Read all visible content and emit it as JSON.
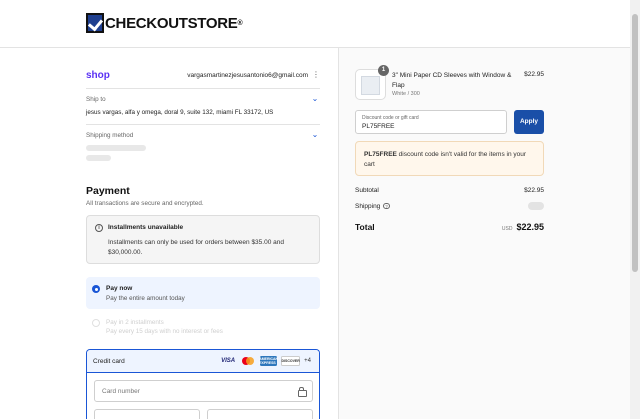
{
  "header": {
    "brand": "CHECKOUTSTORE",
    "brand_mark": "®"
  },
  "account": {
    "shop_logo": "shop",
    "email": "vargasmartinezjesusantonio6@gmail.com",
    "menu_icon": "more-vertical-icon"
  },
  "ship_to": {
    "label": "Ship to",
    "value": "jesus vargas, alfa y omega, doral 9, suite 132, miami FL 33172, US"
  },
  "shipping_method": {
    "label": "Shipping method"
  },
  "payment": {
    "title": "Payment",
    "subtitle": "All transactions are secure and encrypted.",
    "notice": {
      "title": "Installments unavailable",
      "body": "Installments can only be used for orders between $35.00 and $30,000.00."
    },
    "options": [
      {
        "title": "Pay now",
        "subtitle": "Pay the entire amount today",
        "selected": true
      },
      {
        "title": "Pay in 2 installments",
        "subtitle": "Pay every 15 days with no interest or fees",
        "selected": false
      }
    ],
    "credit_card": {
      "title": "Credit card",
      "brands": [
        "VISA",
        "MASTERCARD",
        "AMERICAN EXPRESS",
        "DISCOVER"
      ],
      "more": "+4",
      "card_number_placeholder": "Card number"
    }
  },
  "summary": {
    "product": {
      "quantity": "1",
      "name": "3\" Mini Paper CD Sleeves with Window & Flap",
      "variant": "White / 300",
      "price": "$22.95"
    },
    "discount": {
      "label": "Discount code or gift card",
      "value": "PL75FREE",
      "apply_label": "Apply",
      "error_code": "PL75FREE",
      "error_text": " discount code isn't valid for the items in your cart"
    },
    "subtotal_label": "Subtotal",
    "subtotal_value": "$22.95",
    "shipping_label": "Shipping",
    "total_label": "Total",
    "currency": "USD",
    "total_value": "$22.95"
  }
}
